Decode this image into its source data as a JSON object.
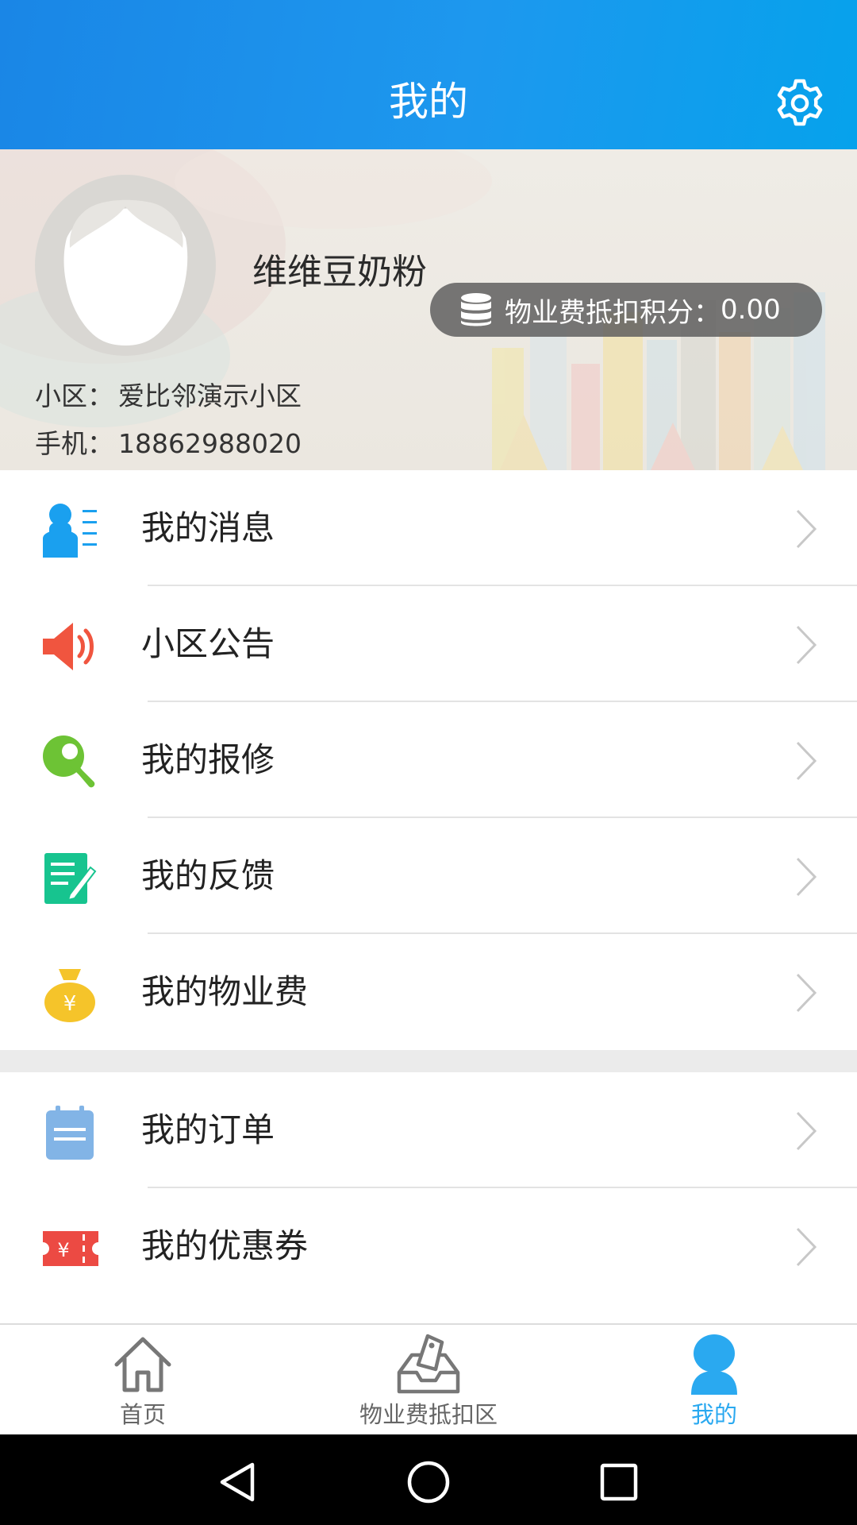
{
  "header": {
    "title": "我的",
    "settings_icon": "gear-icon"
  },
  "profile": {
    "username": "维维豆奶粉",
    "points_label": "物业费抵扣积分：",
    "points_value": "0.00",
    "community_label": "小区：",
    "community_value": "爱比邻演示小区",
    "phone_label": "手机：",
    "phone_value": "18862988020",
    "avatar_icon": "default-avatar-icon"
  },
  "menu": [
    {
      "label": "我的消息",
      "icon": "contact-list-icon",
      "color": "#1aa0ef"
    },
    {
      "label": "小区公告",
      "icon": "speaker-icon",
      "color": "#f0553f"
    },
    {
      "label": "我的报修",
      "icon": "wrench-icon",
      "color": "#6dc335"
    },
    {
      "label": "我的反馈",
      "icon": "edit-note-icon",
      "color": "#17c48f"
    },
    {
      "label": "我的物业费",
      "icon": "money-bag-icon",
      "color": "#f5c42a"
    },
    {
      "label": "我的订单",
      "icon": "order-clipboard-icon",
      "color": "#82b4e6"
    },
    {
      "label": "我的优惠券",
      "icon": "coupon-icon",
      "color": "#ec4a43"
    }
  ],
  "tabs": [
    {
      "label": "首页",
      "icon": "home-icon"
    },
    {
      "label": "物业费抵扣区",
      "icon": "tag-tray-icon"
    },
    {
      "label": "我的",
      "icon": "profile-icon",
      "active": true
    }
  ],
  "colors": {
    "header_blue": "#1a8ee8",
    "accent_blue": "#2aa9f0"
  }
}
